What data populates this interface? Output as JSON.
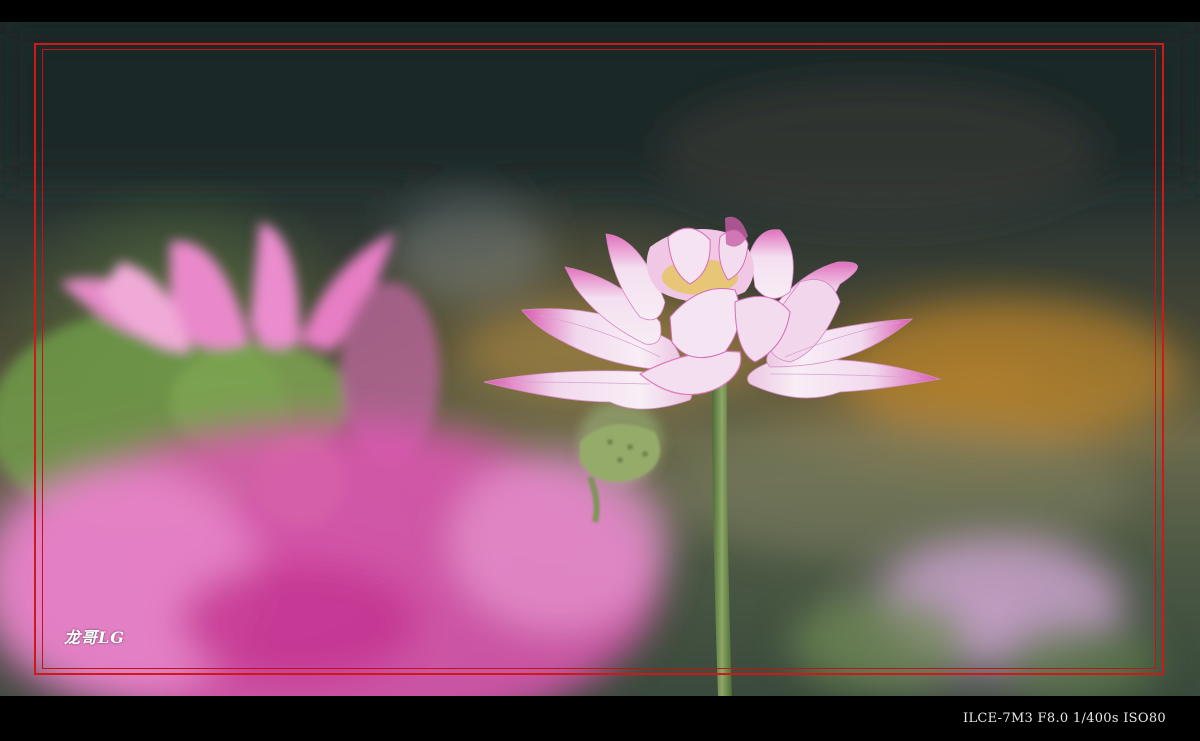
{
  "watermark": {
    "text": "龙哥LG"
  },
  "caption": {
    "exif": "ILCE-7M3 F8.0 1/400s ISO80"
  },
  "colors": {
    "border": "#d01818",
    "background": "#000000",
    "petal_pink": "#e27bc0",
    "petal_white": "#f4e6f2",
    "stem_green": "#6f8a4a"
  }
}
